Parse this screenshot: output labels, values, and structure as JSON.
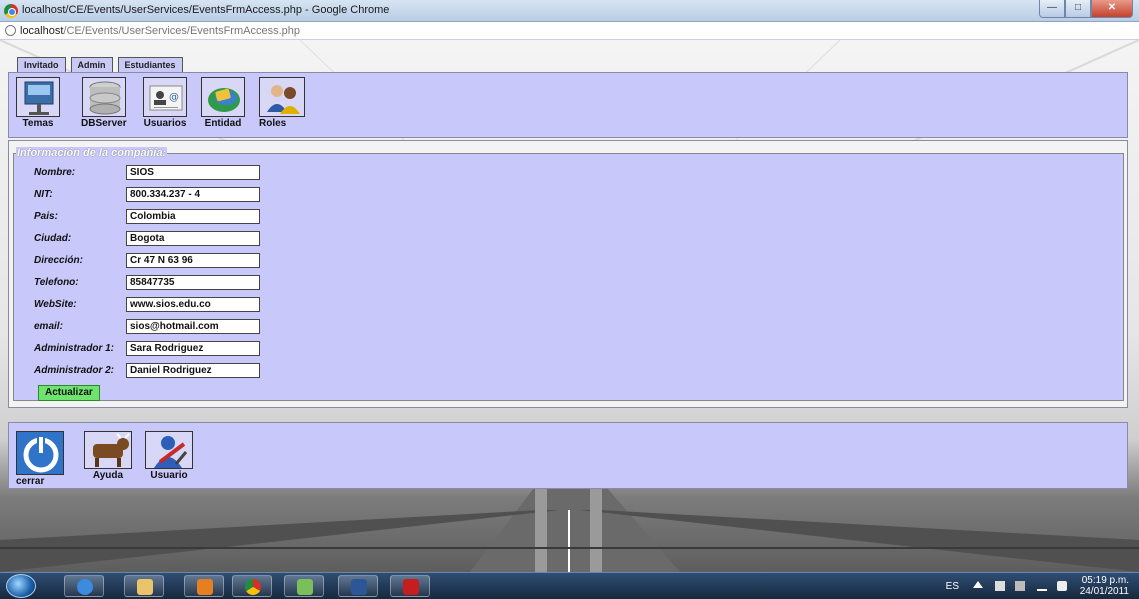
{
  "window": {
    "title": "localhost/CE/Events/UserServices/EventsFrmAccess.php - Google Chrome",
    "controls": [
      "minimize",
      "maximize",
      "close"
    ]
  },
  "address": {
    "host": "localhost",
    "path": "/CE/Events/UserServices/EventsFrmAccess.php"
  },
  "tabs": [
    "Invitado",
    "Admin",
    "Estudiantes"
  ],
  "toolbar": {
    "items": [
      {
        "label": "Temas",
        "icon": "presentation-icon"
      },
      {
        "label": "DBServer",
        "icon": "database-icon"
      },
      {
        "label": "Usuarios",
        "icon": "contact-card-icon"
      },
      {
        "label": "Entidad",
        "icon": "entity-icon"
      },
      {
        "label": "Roles",
        "icon": "user-roles-icon"
      }
    ]
  },
  "company": {
    "legend": "Información de la compañía:",
    "fields": [
      {
        "label": "Nombre:",
        "value": "SIOS"
      },
      {
        "label": "NIT:",
        "value": "800.334.237 - 4"
      },
      {
        "label": "Pais:",
        "value": "Colombia"
      },
      {
        "label": "Ciudad:",
        "value": "Bogota"
      },
      {
        "label": "Dirección:",
        "value": "Cr 47 N 63 96"
      },
      {
        "label": "Telefono:",
        "value": "85847735"
      },
      {
        "label": "WebSite:",
        "value": "www.sios.edu.co"
      },
      {
        "label": "email:",
        "value": "sios@hotmail.com"
      },
      {
        "label": "Administrador 1:",
        "value": "Sara Rodriguez"
      },
      {
        "label": "Administrador 2:",
        "value": "Daniel Rodriguez"
      }
    ],
    "submit_label": "Actualizar"
  },
  "bottom_bar": {
    "items": [
      {
        "label": "cerrar",
        "icon": "power-icon"
      },
      {
        "label": "Ayuda",
        "icon": "cow-icon"
      },
      {
        "label": "Usuario",
        "icon": "user-tools-icon"
      }
    ]
  },
  "taskbar": {
    "apps": [
      "internet-explorer-icon",
      "file-explorer-icon",
      "media-player-icon",
      "chrome-icon",
      "notepad-icon",
      "word-icon",
      "acrobat-icon"
    ],
    "language": "ES",
    "time": "05:19 p.m.",
    "date": "24/01/2011"
  }
}
